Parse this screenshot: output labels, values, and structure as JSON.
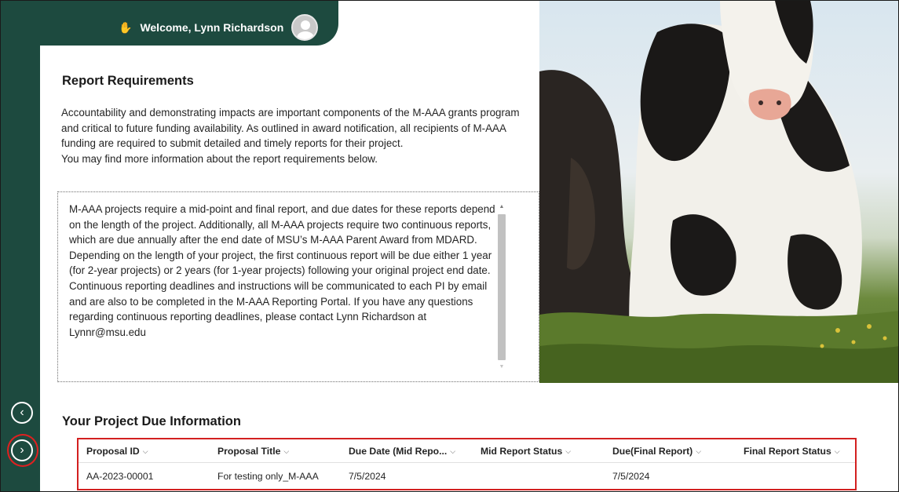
{
  "header": {
    "welcome_text": "Welcome, Lynn Richardson",
    "wave_icon": "✋"
  },
  "report_requirements": {
    "title": "Report Requirements",
    "intro": "Accountability and demonstrating impacts are important components of the M-AAA grants program and critical to future funding availability. As outlined in award notification, all recipients of M-AAA funding are required to submit detailed and timely reports for their project.",
    "more_info": "You may find more information about the report requirements below.",
    "details": "M-AAA projects require a mid-point and final report, and due dates for these reports depend on the length of the project. Additionally, all M-AAA projects require two continuous reports, which are due annually after the end date of MSU’s M-AAA Parent Award from MDARD. Depending on the length of your project, the first continuous report will be due either 1 year (for 2-year projects) or 2 years (for 1-year projects) following your original project end date. Continuous reporting deadlines and instructions will be communicated to each PI by email and are also to be completed in the M-AAA Reporting Portal. If you have any questions regarding continuous reporting deadlines, please contact Lynn Richardson at Lynnr@msu.edu"
  },
  "due_info": {
    "title": "Your Project Due Information",
    "columns": [
      "Proposal ID",
      "Proposal Title",
      "Due Date (Mid Repo...",
      "Mid Report Status",
      "Due(Final Report)",
      "Final Report Status"
    ],
    "rows": [
      {
        "proposal_id": "AA-2023-00001",
        "proposal_title": "For testing only_M-AAA",
        "due_mid": "7/5/2024",
        "mid_status": "",
        "due_final": "7/5/2024",
        "final_status": ""
      }
    ]
  },
  "nav": {
    "prev_icon": "‹",
    "next_icon": "›"
  },
  "colors": {
    "rail": "#1d4a3f",
    "highlight_border": "#d32020"
  },
  "icons": {
    "chevron": "⌵"
  }
}
